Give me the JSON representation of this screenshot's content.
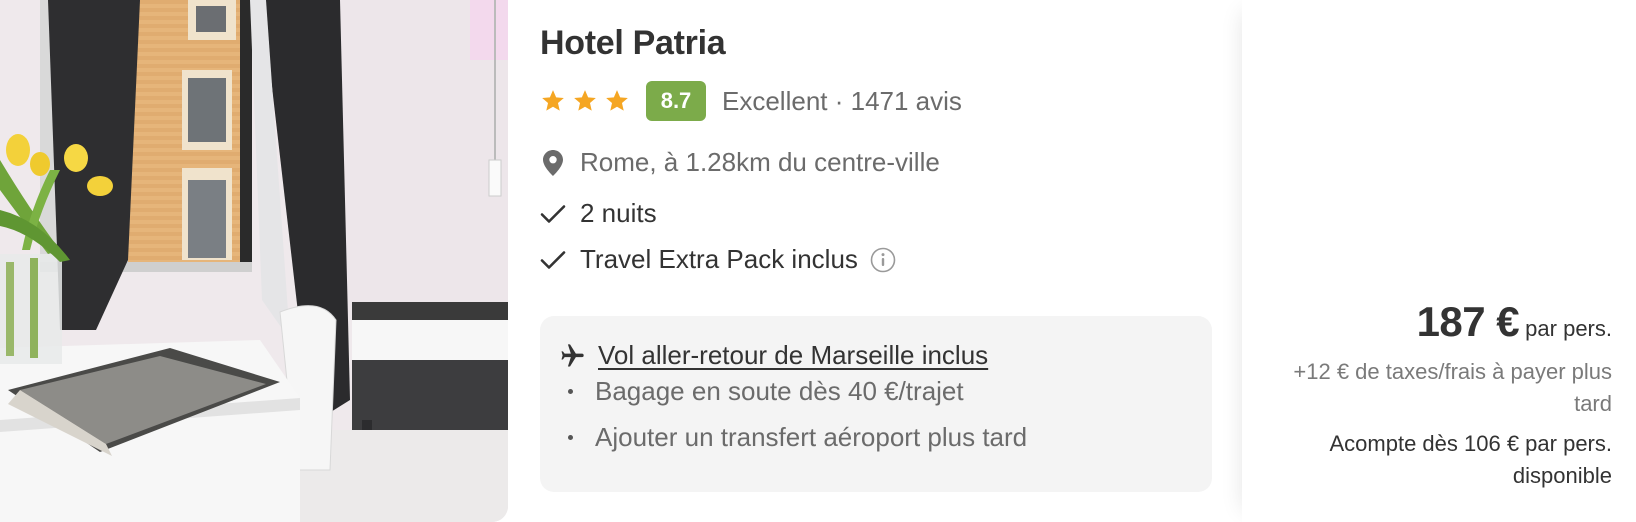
{
  "hotel": {
    "name": "Hotel Patria",
    "stars": 3,
    "score": "8.7",
    "rating_text": "Excellent · 1471 avis",
    "location": "Rome, à 1.28km du centre-ville",
    "features": [
      {
        "label": "2 nuits"
      },
      {
        "label": "Travel Extra Pack inclus"
      }
    ]
  },
  "flight": {
    "headline": "Vol aller-retour de Marseille inclus",
    "items": [
      {
        "label": "Bagage en soute dès 40 €/trajet"
      },
      {
        "label": "Ajouter un transfert aéroport plus tard"
      }
    ]
  },
  "price": {
    "amount": "187 €",
    "unit": "par pers.",
    "taxes": "+12 € de taxes/frais à payer plus tard",
    "deposit": "Acompte dès 106 € par pers. disponible"
  },
  "colors": {
    "star": "#f5a623",
    "score_badge": "#7cab4a",
    "text_primary": "#333333",
    "text_secondary": "#6b6b6b",
    "flight_box_bg": "#f4f4f4"
  },
  "icons": {
    "star": "star-icon",
    "location": "map-pin-icon",
    "check": "checkmark-icon",
    "info": "info-circle-icon",
    "plane": "airplane-icon"
  }
}
